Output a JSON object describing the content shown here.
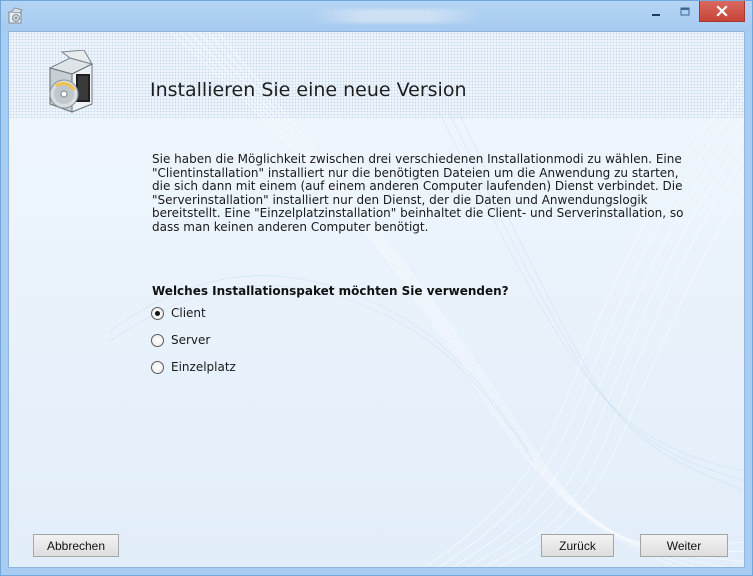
{
  "window": {
    "title": "",
    "minimize_label": "Minimize",
    "maximize_label": "Maximize",
    "close_label": "Close"
  },
  "header": {
    "title": "Installieren Sie eine neue Version"
  },
  "content": {
    "description_lines": [
      "Sie haben die Möglichkeit zwischen drei verschiedenen Installationmodi zu wählen. Eine",
      "\"Clientinstallation\" installiert nur die benötigten Dateien um die Anwendung zu starten,",
      "die sich dann mit einem (auf einem anderen Computer laufenden) Dienst verbindet. Die",
      "\"Serverinstallation\" installiert nur den Dienst, der die Daten und Anwendungslogik",
      "bereitstellt. Eine \"Einzelplatzinstallation\" beinhaltet die Client- und Serverinstallation, so",
      "dass man keinen anderen Computer benötigt."
    ],
    "question": "Welches Installationspaket möchten Sie verwenden?",
    "options": [
      {
        "label": "Client",
        "selected": true
      },
      {
        "label": "Server",
        "selected": false
      },
      {
        "label": "Einzelplatz",
        "selected": false
      }
    ]
  },
  "footer": {
    "cancel_label": "Abbrechen",
    "back_label": "Zurück",
    "next_label": "Weiter"
  },
  "colors": {
    "frame": "#a9cdf2",
    "close_button": "#c74437",
    "client_background": "#e6f0fb"
  }
}
